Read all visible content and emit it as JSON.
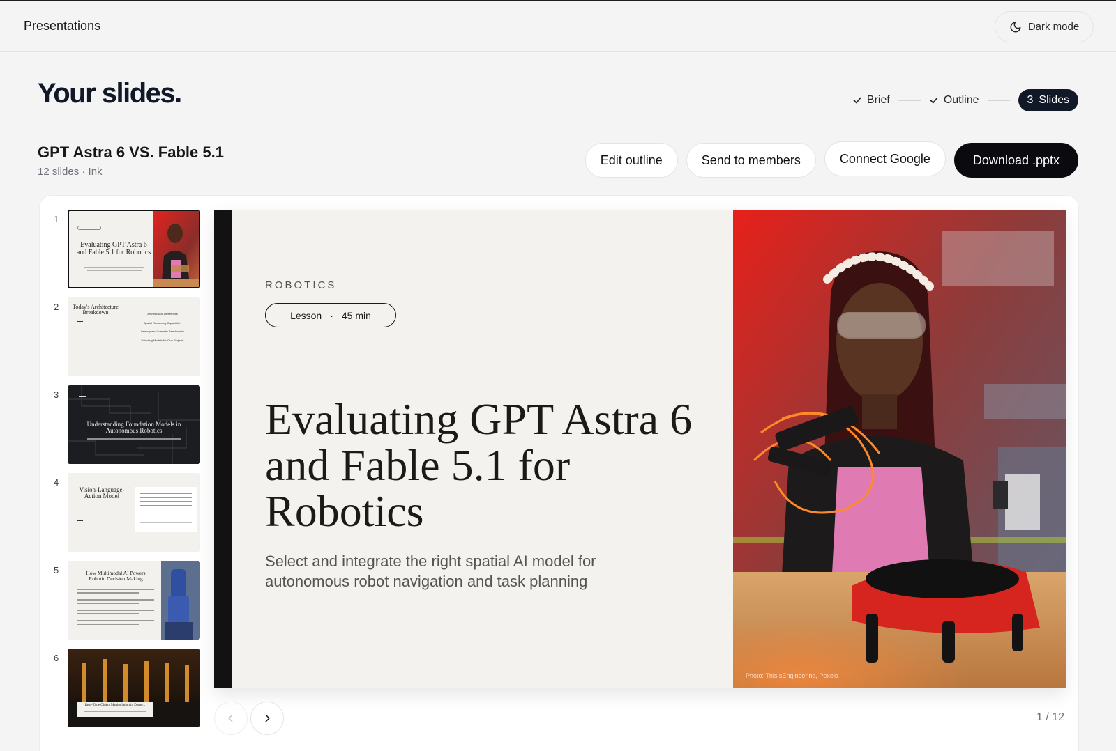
{
  "header": {
    "title": "Presentations",
    "dark_mode_label": "Dark mode"
  },
  "page": {
    "heading": "Your slides."
  },
  "steps": [
    {
      "label": "Brief",
      "state": "done"
    },
    {
      "label": "Outline",
      "state": "done"
    },
    {
      "number": "3",
      "label": "Slides",
      "state": "active"
    }
  ],
  "deck": {
    "title": "GPT Astra 6 VS. Fable 5.1",
    "meta": "12 slides · Ink"
  },
  "actions": {
    "edit_outline": "Edit outline",
    "send_members": "Send to members",
    "connect_google": "Connect Google",
    "download": "Download .pptx"
  },
  "thumbnails": [
    {
      "number": "1",
      "title": "Evaluating GPT Astra 6 and Fable 5.1 for Robotics",
      "selected": true
    },
    {
      "number": "2",
      "title": "Today's Architecture Breakdown",
      "items": [
        "Architectural Differences",
        "Spatial Reasoning Capabilities",
        "Latency and Compute Benchmarks",
        "Selecting Models for Club Projects"
      ]
    },
    {
      "number": "3",
      "title": "Understanding Foundation Models in Autonomous Robotics"
    },
    {
      "number": "4",
      "title": "Vision-Language-Action Model"
    },
    {
      "number": "5",
      "title": "How Multimodal AI Powers Robotic Decision Making"
    },
    {
      "number": "6",
      "title": "Real-Time Object Manipulation in Dome..."
    }
  ],
  "slide": {
    "eyebrow": "ROBOTICS",
    "badge_type": "Lesson",
    "badge_sep": "·",
    "badge_duration": "45 min",
    "title": "Evaluating GPT Astra 6 and Fable 5.1 for Robotics",
    "subtitle": "Select and integrate the right spatial AI model for autonomous robot navigation and task planning",
    "photo_credit": "Photo: ThisIsEngineering, Pexels"
  },
  "pager": {
    "counter": "1 / 12"
  },
  "colors": {
    "accent": "#0b0b0f",
    "background": "#f4f4f5",
    "slide_bg": "#f3f2ee"
  },
  "icons": {
    "dark_mode": "moon-icon",
    "step_done": "check-icon",
    "prev": "chevron-left-icon",
    "next": "chevron-right-icon"
  }
}
